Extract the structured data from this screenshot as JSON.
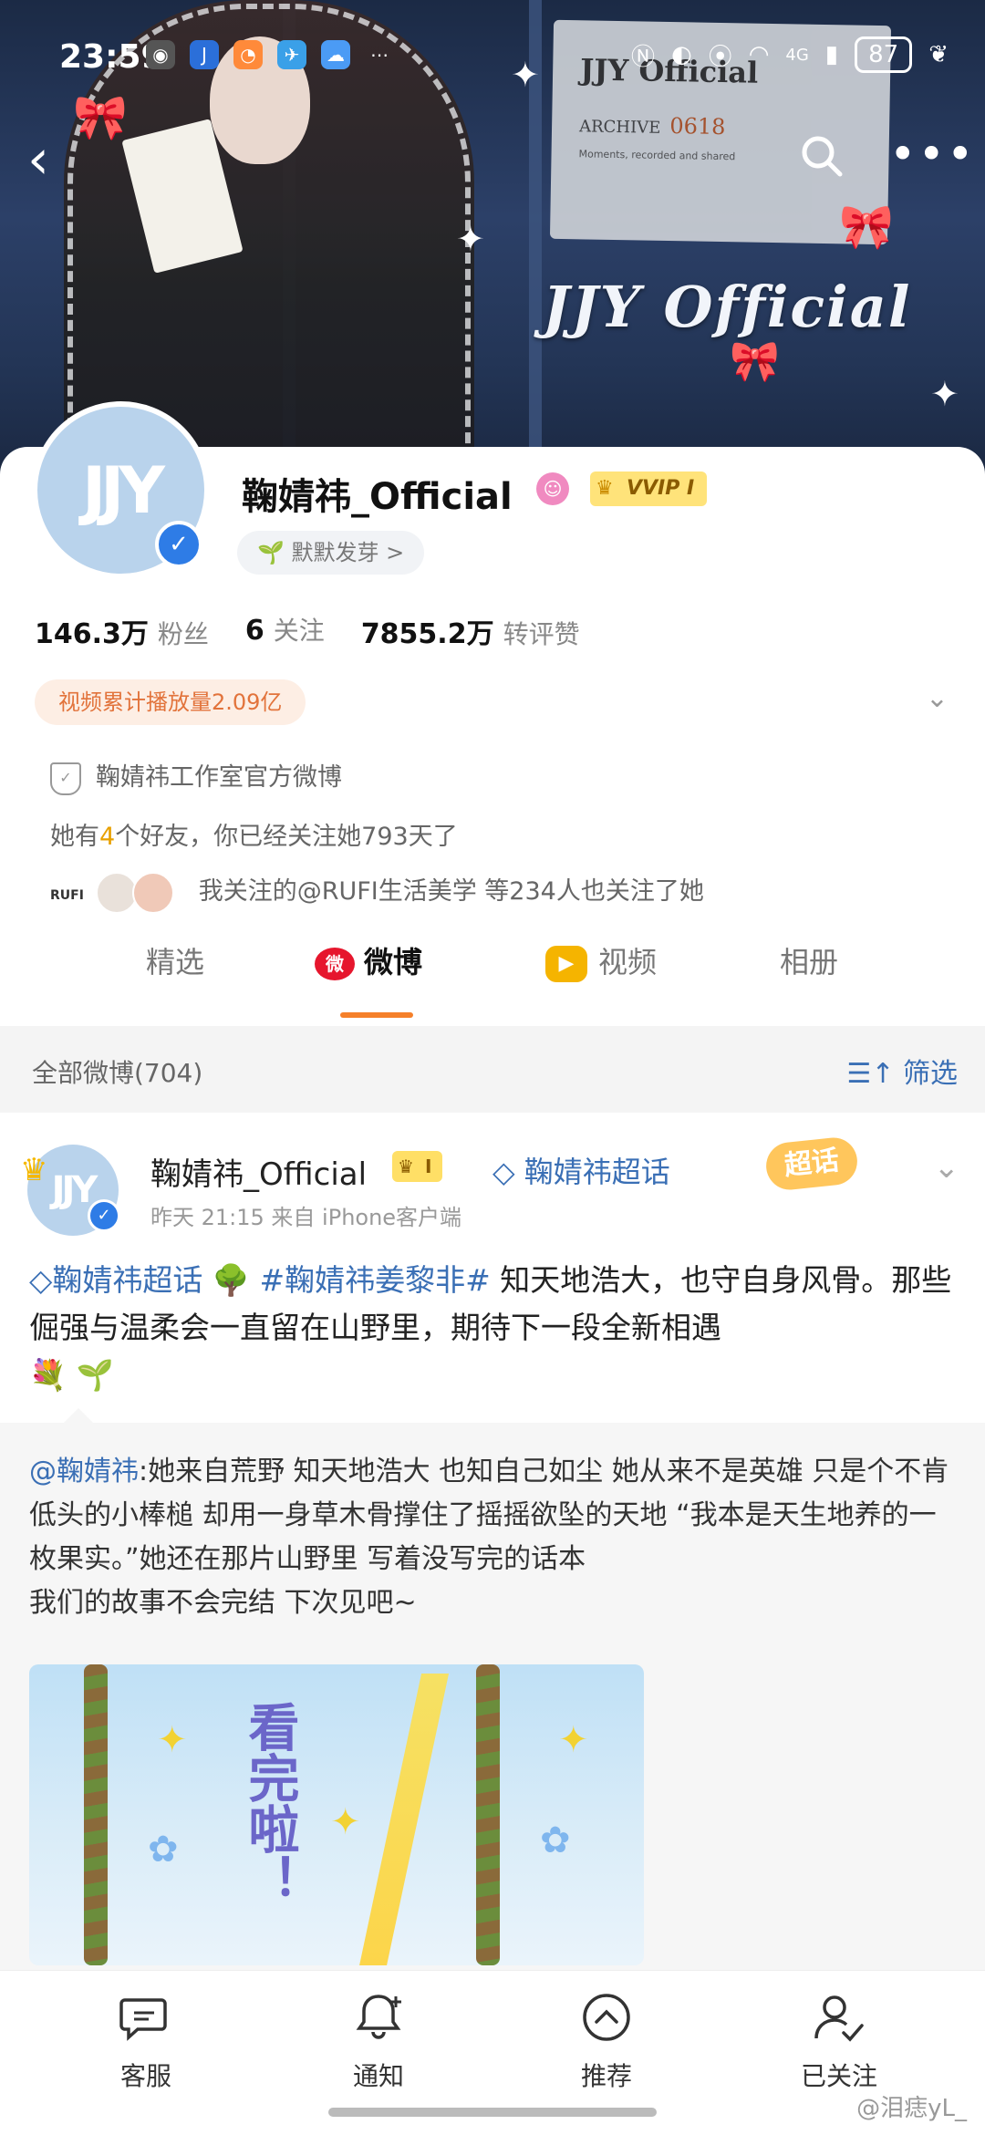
{
  "status_bar": {
    "time": "23:59",
    "battery": "87",
    "network": "4G"
  },
  "banner": {
    "archive_title": "JJY Official",
    "archive_sub": "ARCHIVE",
    "archive_num": "0618",
    "archive_small": "Moments, recorded and shared",
    "brand_text": "JJY Official"
  },
  "profile": {
    "avatar_text": "JJY",
    "name": "鞠婧祎_Official",
    "vip_label": "VVIP I",
    "sprout_label": "默默发芽 >",
    "stats": [
      {
        "value": "146.3万",
        "label": "粉丝"
      },
      {
        "value": "6",
        "label": "关注"
      },
      {
        "value": "7855.2万",
        "label": "转评赞"
      }
    ],
    "play_count": "视频累计播放量2.09亿",
    "verified": "鞠婧祎工作室官方微博",
    "friends_prefix": "她有",
    "friends_count": "4",
    "friends_suffix": "个好友，你已经关注她793天了",
    "mutual": "我关注的@RUFI生活美学 等234人也关注了她",
    "mutual_logo": "RUFI"
  },
  "tabs": [
    {
      "label": "精选"
    },
    {
      "label": "微博"
    },
    {
      "label": "视频"
    },
    {
      "label": "相册"
    }
  ],
  "filter": {
    "all_label": "全部微博(704)",
    "sift_label": "筛选"
  },
  "post": {
    "avatar_text": "JJY",
    "author": "鞠婧祎_Official",
    "level": "I",
    "topic": "鞠婧祎超话",
    "super_badge": "超话",
    "meta": "昨天 21:15  来自 iPhone客户端",
    "text_topic": "鞠婧祎超话",
    "text_tag": "#鞠婧祎姜黎非#",
    "text_body": "知天地浩大，也守自身风骨。那些倔强与温柔会一直留在山野里，期待下一段全新相遇",
    "emoji": "💐 🌱",
    "tree_emoji": "🌳",
    "repost_mention": "@鞠婧祎",
    "repost_body": ":她来自荒野 知天地浩大 也知自己如尘 她从来不是英雄 只是个不肯低头的小棒槌 却用一身草木骨撑住了摇摇欲坠的天地 “我本是天生地养的一枚果实。”她还在那片山野里 写着没写完的话本",
    "repost_end": "我们的故事不会完结 下次见吧~",
    "image_text": "看完啦！"
  },
  "bottom_nav": [
    {
      "label": "客服",
      "icon": "chat-icon"
    },
    {
      "label": "通知",
      "icon": "bell-icon"
    },
    {
      "label": "推荐",
      "icon": "recommend-icon"
    },
    {
      "label": "已关注",
      "icon": "followed-user-icon"
    }
  ],
  "watermark": "@泪痣yL_",
  "colors": {
    "accent": "#f5802a",
    "link": "#3a6fb5",
    "vip": "#ffe37a"
  }
}
